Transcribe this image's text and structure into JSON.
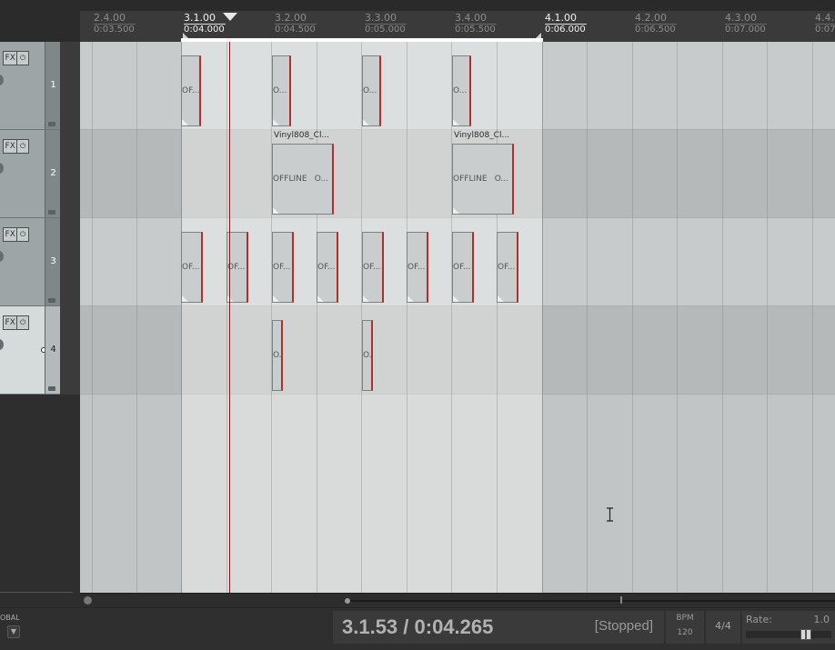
{
  "ruler": {
    "marks": [
      {
        "bar": "2.4.00",
        "time": "0:03.500",
        "active": false
      },
      {
        "bar": "3.1.00",
        "time": "0:04.000",
        "active": true
      },
      {
        "bar": "3.2.00",
        "time": "0:04.500",
        "active": false
      },
      {
        "bar": "3.3.00",
        "time": "0:05.000",
        "active": false
      },
      {
        "bar": "3.4.00",
        "time": "0:05.500",
        "active": false
      },
      {
        "bar": "4.1.00",
        "time": "0:06.000",
        "active": true
      },
      {
        "bar": "4.2.00",
        "time": "0:06.500",
        "active": false
      },
      {
        "bar": "4.3.00",
        "time": "0:07.000",
        "active": false
      },
      {
        "bar": "4.4.0",
        "time": "0:07.",
        "active": false
      }
    ]
  },
  "tracks": [
    {
      "number": "1",
      "fx_label": "FX",
      "selected": false
    },
    {
      "number": "2",
      "fx_label": "FX",
      "selected": false
    },
    {
      "number": "3",
      "fx_label": "FX",
      "selected": false
    },
    {
      "number": "4",
      "fx_label": "FX",
      "selected": true
    }
  ],
  "items": {
    "track1": [
      {
        "text": "OF..."
      },
      {
        "text": "O..."
      },
      {
        "text": "O..."
      },
      {
        "text": "O..."
      }
    ],
    "track2": [
      {
        "name": "Vinyl808_Cl...",
        "text": "OFFLINE",
        "text2": "O..."
      },
      {
        "name": "Vinyl808_Cl...",
        "text": "OFFLINE",
        "text2": "O..."
      }
    ],
    "track3": [
      {
        "text": "OF..."
      },
      {
        "text": "OF..."
      },
      {
        "text": "OF..."
      },
      {
        "text": "OF..."
      },
      {
        "text": "OF..."
      },
      {
        "text": "OF..."
      },
      {
        "text": "OF..."
      },
      {
        "text": "OF..."
      }
    ],
    "track4": [
      {
        "text": "O."
      },
      {
        "text": "O."
      }
    ]
  },
  "transport": {
    "global_label": "OBAL",
    "time": "3.1.53 / 0:04.265",
    "state": "[Stopped]",
    "bpm_label": "BPM",
    "bpm": "120",
    "time_signature": "4/4",
    "rate_label": "Rate:",
    "rate": "1.0"
  }
}
